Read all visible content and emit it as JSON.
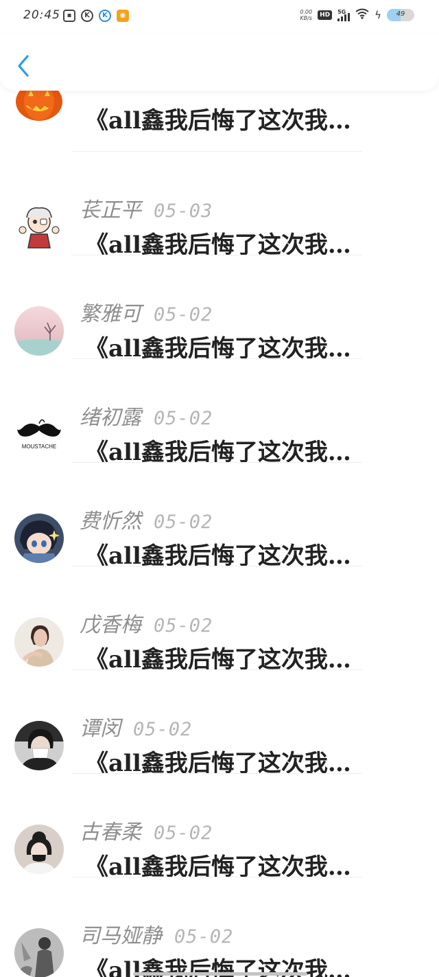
{
  "status_bar": {
    "time": "20:45",
    "icons_left": [
      "tv-icon",
      "k-circle-icon",
      "k-blue-icon",
      "weibo-icon"
    ],
    "net_speed_value": "0.00",
    "net_speed_unit": "KB/s",
    "hd_label": "HD",
    "network_label": "5G",
    "battery_text": "49",
    "battery_level": 0.49
  },
  "header": {
    "back_icon": "chevron-left-icon",
    "accent_color": "#2b9de5"
  },
  "items": [
    {
      "name": "",
      "date": "",
      "message": "《all鑫我后悔了这次我…",
      "avatar": "pumpkin"
    },
    {
      "name": "苌正平",
      "date": "05-03",
      "message": "《all鑫我后悔了这次我…",
      "avatar": "cartoon"
    },
    {
      "name": "繁雅可",
      "date": "05-02",
      "message": "《all鑫我后悔了这次我…",
      "avatar": "landscape"
    },
    {
      "name": "绪初露",
      "date": "05-02",
      "message": "《all鑫我后悔了这次我…",
      "avatar": "moustache",
      "avatar_text": "MOUSTACHE"
    },
    {
      "name": "费忻然",
      "date": "05-02",
      "message": "《all鑫我后悔了这次我…",
      "avatar": "anime"
    },
    {
      "name": "戊香梅",
      "date": "05-02",
      "message": "《all鑫我后悔了这次我…",
      "avatar": "woman"
    },
    {
      "name": "谭闵",
      "date": "05-02",
      "message": "《all鑫我后悔了这次我…",
      "avatar": "masked"
    },
    {
      "name": "古春柔",
      "date": "05-02",
      "message": "《all鑫我后悔了这次我…",
      "avatar": "girl"
    },
    {
      "name": "司马娅静",
      "date": "05-02",
      "message": "《all鑫我后悔了这次我…",
      "avatar": "bw-photo"
    }
  ]
}
